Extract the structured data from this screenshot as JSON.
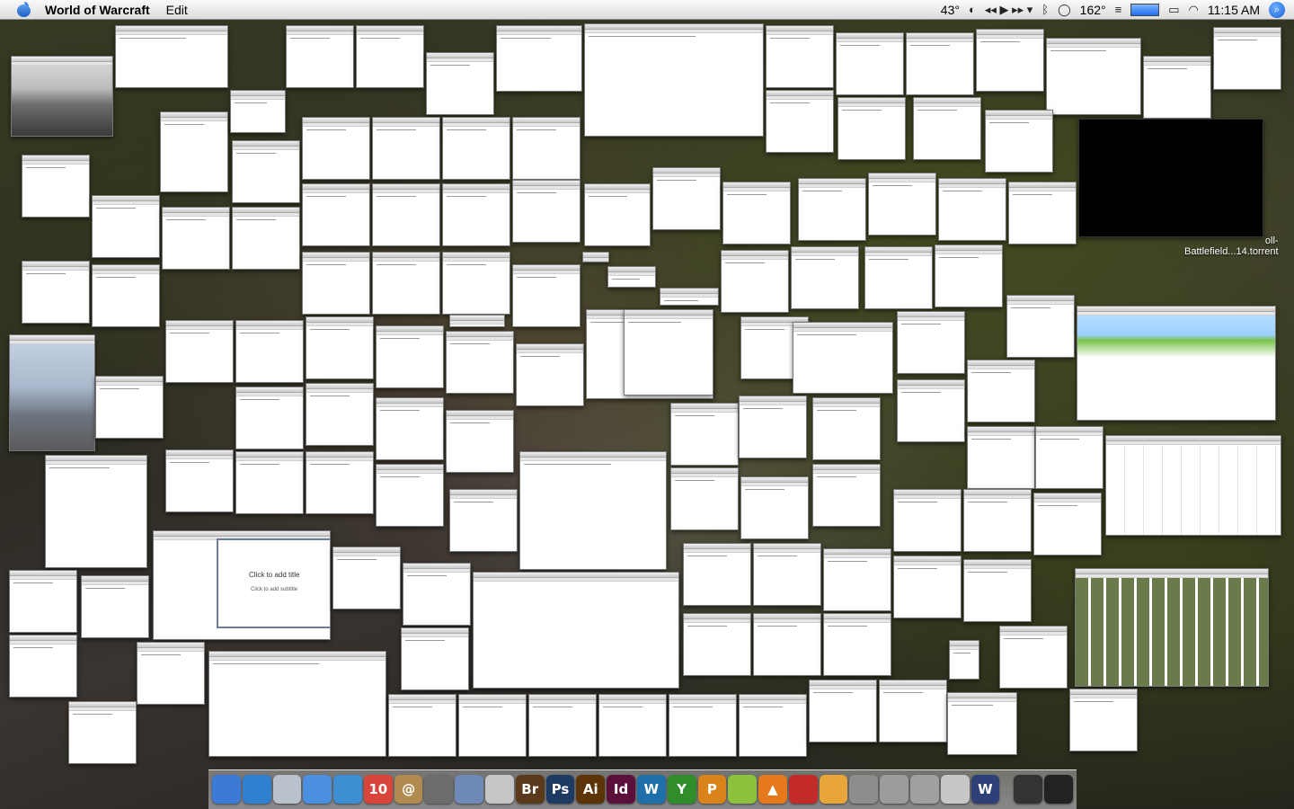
{
  "menubar": {
    "app_name": "World of Warcraft",
    "menus": [
      "Edit"
    ],
    "status": {
      "temperature": "43°",
      "sync_icon": "sync-icon",
      "media_controls": "◂◂ ▶ ▸▸ ▾",
      "bluetooth_icon": "bluetooth-icon",
      "speech_icon": "speech-bubble-icon",
      "temp2": "162°",
      "time": "11:15 AM",
      "spotlight_icon": "spotlight-icon"
    }
  },
  "desktop": {
    "torrent_label": "Battlefield...14.torrent",
    "torrent_label_top": "oll-"
  },
  "windows": {
    "slide_title": "Click to add title",
    "slide_subtitle": "Click to add subtitle"
  },
  "dock": {
    "items": [
      {
        "name": "finder",
        "label": "",
        "color": "#3c7ad8"
      },
      {
        "name": "safari",
        "label": "",
        "color": "#2f80d1"
      },
      {
        "name": "mail",
        "label": "",
        "color": "#b9c2cc"
      },
      {
        "name": "ichat",
        "label": "",
        "color": "#4a8fe0"
      },
      {
        "name": "itunes",
        "label": "",
        "color": "#3d8fd4"
      },
      {
        "name": "ical",
        "label": "10",
        "color": "#d9453a"
      },
      {
        "name": "address-book",
        "label": "@",
        "color": "#b08a50"
      },
      {
        "name": "iphoto",
        "label": "",
        "color": "#6c6c6c"
      },
      {
        "name": "preview",
        "label": "",
        "color": "#6f8ab8"
      },
      {
        "name": "textedit",
        "label": "",
        "color": "#c6c6c6"
      },
      {
        "name": "bridge",
        "label": "Br",
        "color": "#5b3a1c"
      },
      {
        "name": "photoshop",
        "label": "Ps",
        "color": "#1d3a63"
      },
      {
        "name": "illustrator",
        "label": "Ai",
        "color": "#5c3408"
      },
      {
        "name": "indesign",
        "label": "Id",
        "color": "#5b0f3b"
      },
      {
        "name": "dreamweaver",
        "label": "W",
        "color": "#1f6fa9"
      },
      {
        "name": "app-green",
        "label": "Y",
        "color": "#2f8d2a"
      },
      {
        "name": "app-orange",
        "label": "P",
        "color": "#d8841b"
      },
      {
        "name": "app-lime",
        "label": "",
        "color": "#8cc23c"
      },
      {
        "name": "vlc",
        "label": "▲",
        "color": "#e6791c"
      },
      {
        "name": "app-red",
        "label": "",
        "color": "#c32b2b"
      },
      {
        "name": "app-box",
        "label": "",
        "color": "#e8a53a"
      },
      {
        "name": "app-tool",
        "label": "",
        "color": "#8d8d8d"
      },
      {
        "name": "calculator",
        "label": "",
        "color": "#9c9c9c"
      },
      {
        "name": "system-preferences",
        "label": "",
        "color": "#a0a0a0"
      },
      {
        "name": "app-docs",
        "label": "",
        "color": "#c7c7c7"
      },
      {
        "name": "world-of-warcraft",
        "label": "W",
        "color": "#2f3f77"
      },
      {
        "name": "stack-1",
        "label": "",
        "color": "#333333"
      },
      {
        "name": "trash",
        "label": "",
        "color": "#222222"
      }
    ]
  }
}
